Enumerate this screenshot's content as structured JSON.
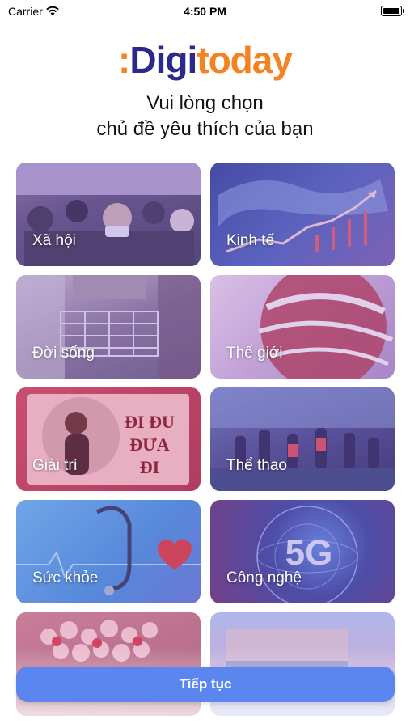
{
  "status_bar": {
    "carrier": "Carrier",
    "time": "4:50 PM"
  },
  "logo": {
    "colon": ":",
    "digi": "Digi",
    "today": "today"
  },
  "heading": {
    "line1": "Vui lòng chọn",
    "line2": "chủ đề yêu thích của bạn"
  },
  "topics": [
    {
      "label": "Xã hội",
      "image": "crowd-photo"
    },
    {
      "label": "Kinh tế",
      "image": "stock-chart-map"
    },
    {
      "label": "Đời sống",
      "image": "shopping-cart-photo"
    },
    {
      "label": "Thế giới",
      "image": "globe-graphic"
    },
    {
      "label": "Giải trí",
      "image": "music-cover"
    },
    {
      "label": "Thể thao",
      "image": "football-photo"
    },
    {
      "label": "Sức khỏe",
      "image": "stethoscope-heart"
    },
    {
      "label": "Công nghệ",
      "image": "5g-globe"
    },
    {
      "label": "",
      "image": "flowers-photo"
    },
    {
      "label": "",
      "image": "landscape-photo"
    }
  ],
  "card_overlays": {
    "cool": "rgba(120,100,220,0.35)",
    "warm": "rgba(200,60,120,0.30)"
  },
  "decor_text": {
    "music_title": "ĐI ĐU ĐƯA ĐI",
    "tech_badge": "5G"
  },
  "continue_button": {
    "label": "Tiếp tục",
    "color": "#5b86f0"
  },
  "colors": {
    "brand_orange": "#f58220",
    "brand_navy": "#2b2a8c"
  }
}
